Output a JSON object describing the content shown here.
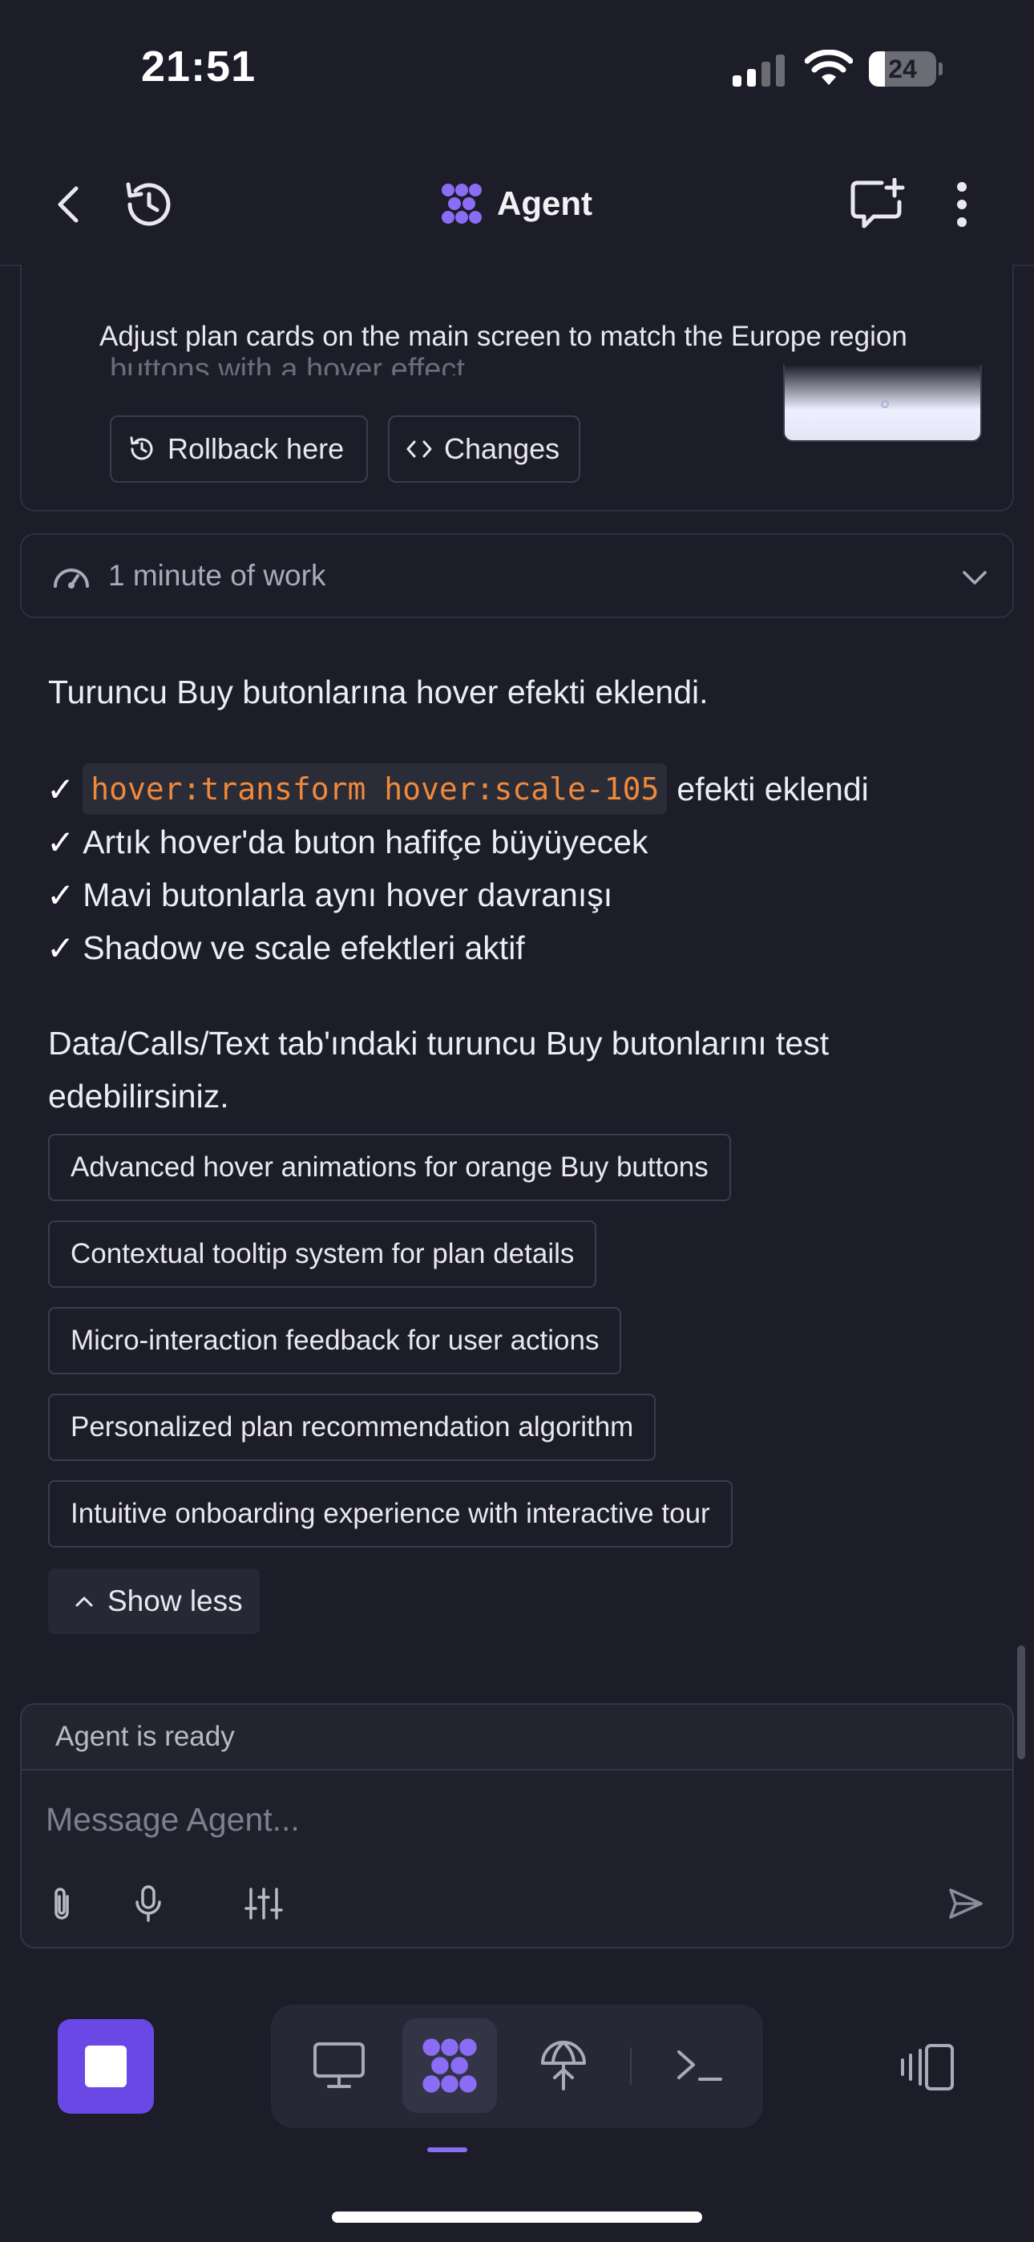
{
  "status_bar": {
    "time": "21:51",
    "battery": "24",
    "battery_level": 0.24
  },
  "header": {
    "title": "Agent"
  },
  "previous_card": {
    "title": "Adjust plan cards on the main screen to match the Europe region",
    "cut_text": "buttons with a hover effect",
    "rollback_label": "Rollback here",
    "changes_label": "Changes"
  },
  "work_summary": {
    "label": "1 minute of work"
  },
  "message": {
    "intro": "Turuncu Buy butonlarına hover efekti eklendi.",
    "checks": [
      {
        "mark": "✓",
        "code": "hover:transform hover:scale-105",
        "text": "efekti eklendi"
      },
      {
        "mark": "✓",
        "text": "Artık hover'da buton hafifçe büyüyecek"
      },
      {
        "mark": "✓",
        "text": "Mavi butonlarla aynı hover davranışı"
      },
      {
        "mark": "✓",
        "text": "Shadow ve scale efektleri aktif"
      }
    ],
    "closing": "Data/Calls/Text tab'ındaki turuncu Buy butonlarını test edebilirsiniz."
  },
  "suggestions": [
    "Advanced hover animations for orange Buy buttons",
    "Contextual tooltip system for plan details",
    "Micro-interaction feedback for user actions",
    "Personalized plan recommendation algorithm",
    "Intuitive onboarding experience with interactive tour"
  ],
  "show_less_label": "Show less",
  "composer": {
    "status": "Agent is ready",
    "placeholder": "Message Agent..."
  },
  "icons": {
    "back": "chevron-left-icon",
    "history": "history-icon",
    "new_chat": "new-chat-icon",
    "more": "more-vertical-icon",
    "brand": "agent-logo-icon",
    "accent": "#8b6cf5",
    "stop_color": "#6a48e6",
    "code_color": "#f0893a"
  }
}
